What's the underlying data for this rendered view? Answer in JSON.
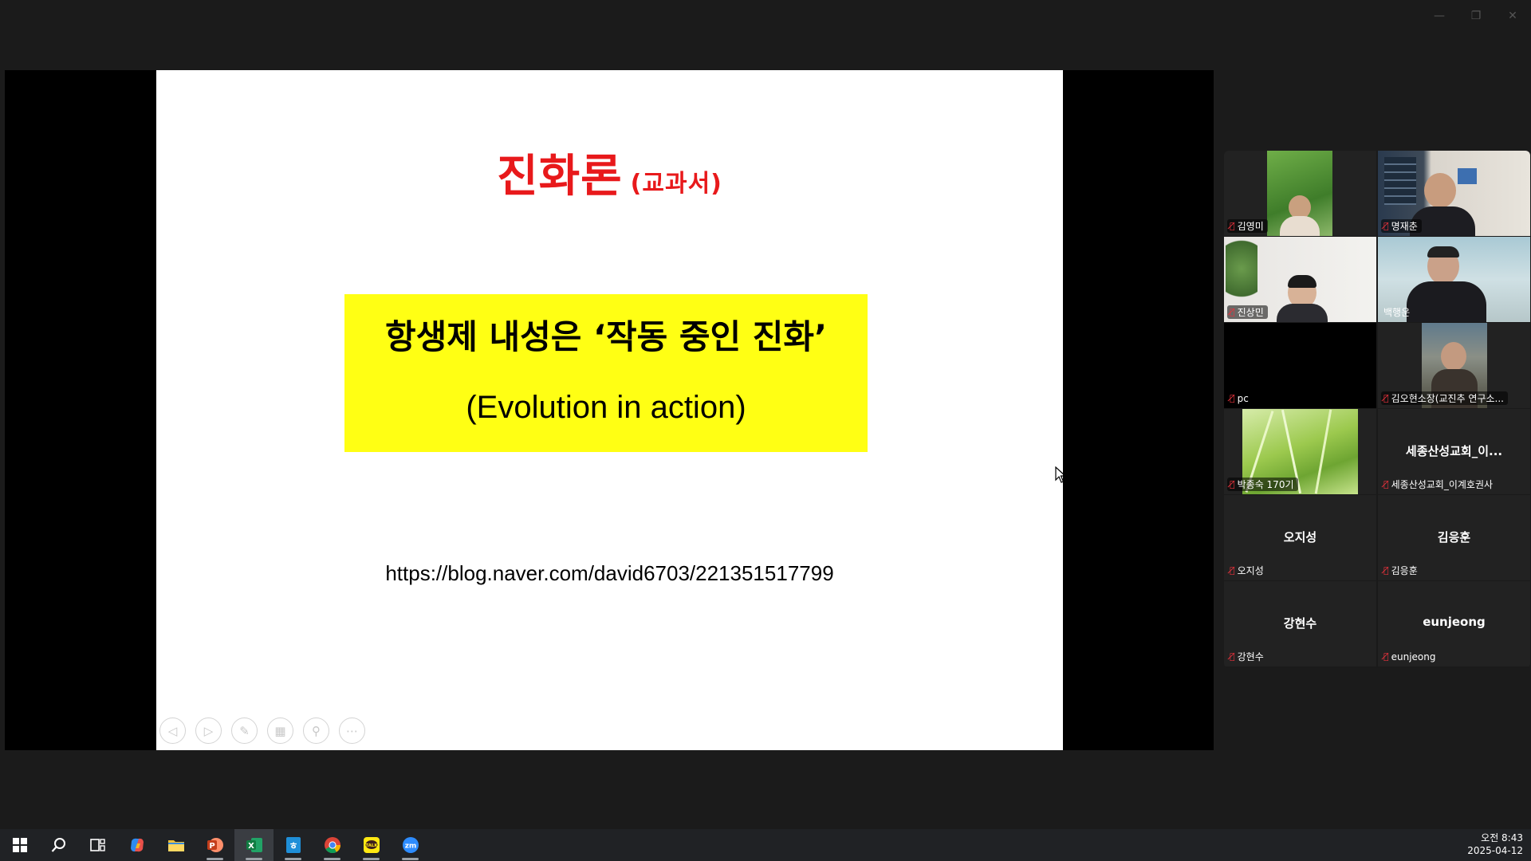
{
  "window": {
    "minimize_glyph": "—",
    "restore_glyph": "❐",
    "close_glyph": "✕"
  },
  "slide": {
    "title": "진화론",
    "title_sub": "(교과서)",
    "box_line1": "항생제 내성은  ‘작동 중인 진화’",
    "box_line2": "(Evolution in action)",
    "url": "https://blog.naver.com/david6703/221351517799",
    "colors": {
      "title": "#e8191b",
      "box": "#ffff14"
    },
    "tools": [
      "prev-icon",
      "next-icon",
      "pen-icon",
      "slides-icon",
      "zoom-icon",
      "more-icon"
    ]
  },
  "participants": [
    {
      "name": "김영미",
      "muted": true,
      "center": ""
    },
    {
      "name": "명재춘",
      "muted": true,
      "center": ""
    },
    {
      "name": "진상민",
      "muted": true,
      "center": ""
    },
    {
      "name": "백행운",
      "muted": false,
      "center": ""
    },
    {
      "name": "pc",
      "muted": true,
      "center": ""
    },
    {
      "name": "김오현소장(교진추 연구소...",
      "muted": true,
      "center": ""
    },
    {
      "name": "박종숙 170기",
      "muted": true,
      "center": ""
    },
    {
      "name": "세종산성교회_이계호권사",
      "muted": true,
      "center": "세종산성교회_이..."
    },
    {
      "name": "오지성",
      "muted": true,
      "center": "오지성"
    },
    {
      "name": "김응훈",
      "muted": true,
      "center": "김응훈"
    },
    {
      "name": "강현수",
      "muted": true,
      "center": "강현수"
    },
    {
      "name": "eunjeong",
      "muted": true,
      "center": "eunjeong"
    }
  ],
  "taskbar": {
    "apps": [
      "start-icon",
      "search-icon",
      "task-view-icon",
      "copilot-icon",
      "file-explorer-icon",
      "powerpoint-icon",
      "excel-icon",
      "hangul-icon",
      "chrome-icon",
      "kakaotalk-icon",
      "zoom-icon"
    ],
    "time": "오전 8:43",
    "date": "2025-04-12"
  }
}
